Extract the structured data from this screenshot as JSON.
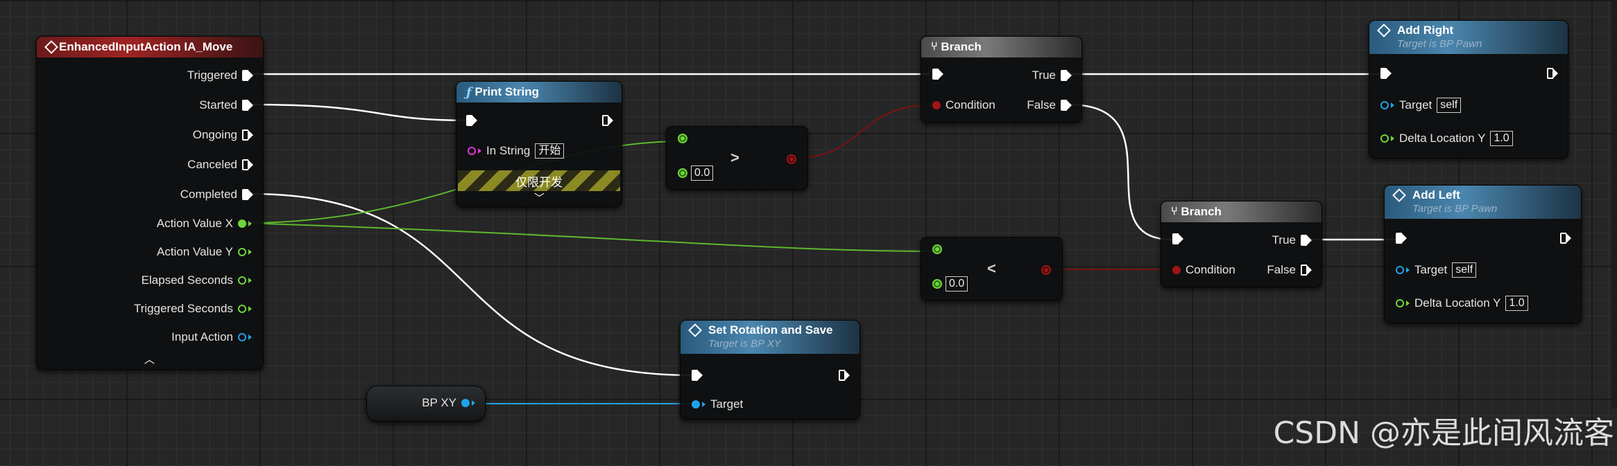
{
  "input_node": {
    "title": "EnhancedInputAction IA_Move",
    "pins": [
      "Triggered",
      "Started",
      "Ongoing",
      "Canceled",
      "Completed",
      "Action Value X",
      "Action Value Y",
      "Elapsed Seconds",
      "Triggered Seconds",
      "Input Action"
    ]
  },
  "print_node": {
    "title": "Print String",
    "in_string_label": "In String",
    "in_string_value": "开始",
    "dev_banner": "仅限开发"
  },
  "greater_node": {
    "operator": ">",
    "default_value": "0.0"
  },
  "less_node": {
    "operator": "<",
    "default_value": "0.0"
  },
  "branch_top": {
    "title": "Branch",
    "condition": "Condition",
    "true_label": "True",
    "false_label": "False"
  },
  "branch_bottom": {
    "title": "Branch",
    "condition": "Condition",
    "true_label": "True",
    "false_label": "False"
  },
  "add_right": {
    "title": "Add Right",
    "subtitle": "Target is BP Pawn",
    "target_label": "Target",
    "target_value": "self",
    "delta_label": "Delta Location Y",
    "delta_value": "1.0"
  },
  "add_left": {
    "title": "Add Left",
    "subtitle": "Target is BP Pawn",
    "target_label": "Target",
    "target_value": "self",
    "delta_label": "Delta Location Y",
    "delta_value": "1.0"
  },
  "set_rotation": {
    "title": "Set Rotation and Save",
    "subtitle": "Target is BP XY",
    "target_label": "Target"
  },
  "bp_var": {
    "label": "BP XY"
  },
  "watermark": "CSDN @亦是此间风流客",
  "colors": {
    "exec": "#ffffff",
    "float": "#6fd63a",
    "bool": "#a11515",
    "object": "#1fa3e8",
    "string": "#e035d6",
    "event_header": "#9e2424",
    "function_header": "#4a86ae",
    "branch_header": "#7a7a7a"
  },
  "icons": {
    "event": "diamond-event-icon",
    "function": "function-f-icon",
    "branch": "branch-icon",
    "collapse": "chevron-up-icon",
    "expand": "chevron-down-icon"
  }
}
